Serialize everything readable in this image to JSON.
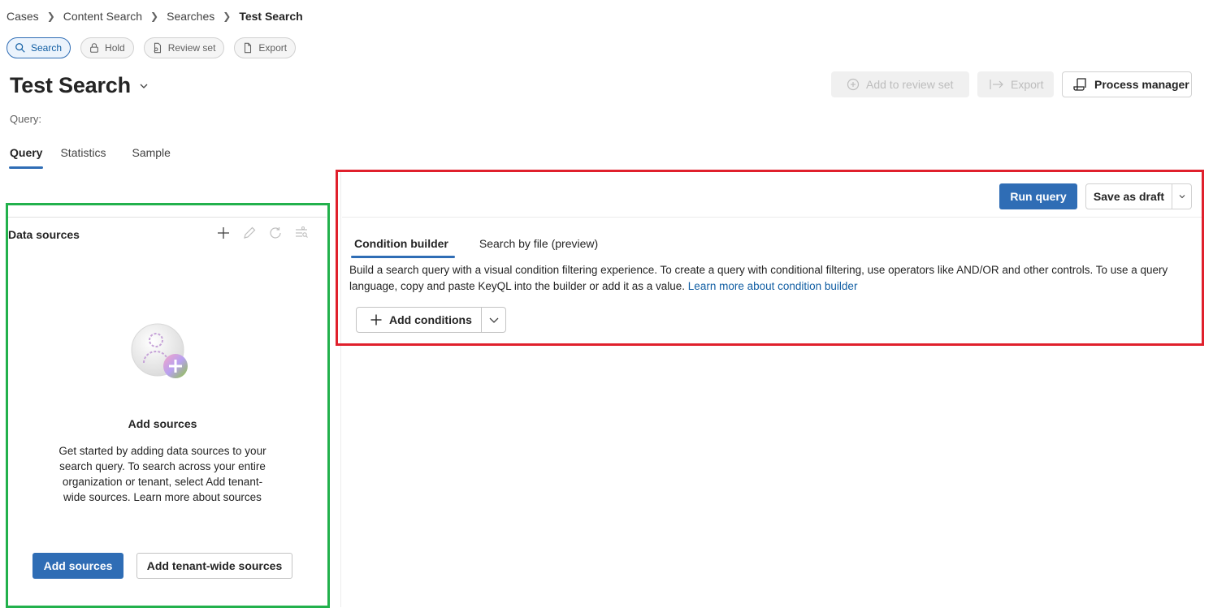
{
  "breadcrumb": {
    "items": [
      "Cases",
      "Content Search",
      "Searches"
    ],
    "current": "Test Search"
  },
  "pill_tabs": {
    "search": "Search",
    "hold": "Hold",
    "review_set": "Review set",
    "export": "Export"
  },
  "page": {
    "title": "Test Search",
    "query_label": "Query:"
  },
  "actions": {
    "add_to_review_set": "Add to review set",
    "export": "Export",
    "process_manager": "Process manager"
  },
  "tabs": [
    "Query",
    "Statistics",
    "Sample"
  ],
  "data_sources": {
    "title": "Data sources",
    "empty_title": "Add sources",
    "empty_description": "Get started by adding data sources to your search query. To search across your entire organization or tenant, select Add tenant-wide sources. Learn more about sources",
    "add_sources": "Add sources",
    "add_tenant_wide": "Add tenant-wide sources"
  },
  "query_panel": {
    "run_query": "Run query",
    "save_as_draft": "Save as draft",
    "tabs": [
      "Condition builder",
      "Search by file (preview)"
    ],
    "description": "Build a search query with a visual condition filtering experience. To create a query with conditional filtering, use operators like AND/OR and other controls. To use a query language, copy and paste KeyQL into the builder or add it as a value.",
    "learn_more": "Learn more about condition builder",
    "add_conditions": "Add conditions"
  },
  "colors": {
    "accent": "#2f6db5",
    "left_highlight": "#22b14c",
    "right_highlight": "#e0202c"
  }
}
